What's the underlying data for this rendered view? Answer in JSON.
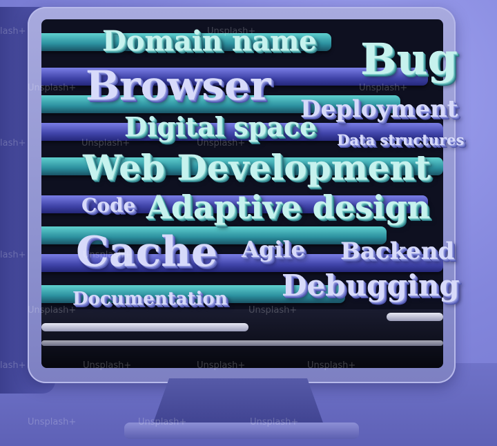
{
  "words": {
    "domain_name": "Domain name",
    "bug": "Bug",
    "browser": "Browser",
    "deployment": "Deployment",
    "digital_space": "Digital space",
    "data_structures": "Data structures",
    "web_development": "Web Development",
    "code": "Code",
    "adaptive_design": "Adaptive design",
    "cache": "Cache",
    "agile": "Agile",
    "backend": "Backend",
    "debugging": "Debugging",
    "documentation": "Documentation"
  },
  "watermark": {
    "text": "Unsplash+",
    "text_left": "lash+"
  },
  "colors": {
    "background": "#7f82d6",
    "monitor": "#9598d4",
    "teal_text": "#c6f2ee",
    "blue_text": "#d7dafa"
  }
}
